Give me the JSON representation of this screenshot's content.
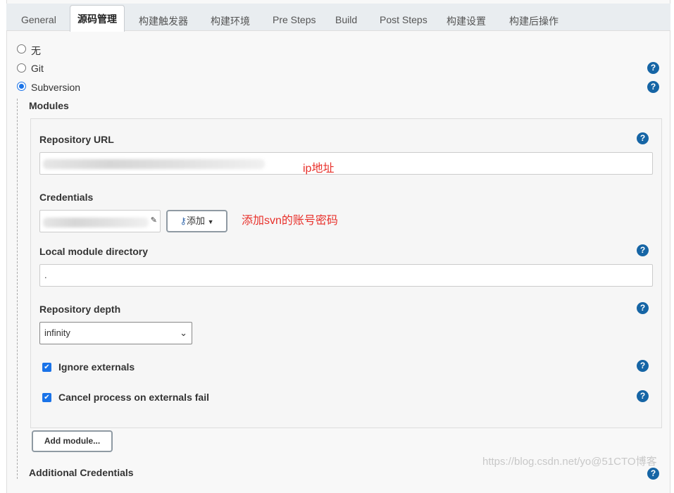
{
  "tabs": [
    {
      "label": "General"
    },
    {
      "label": "源码管理",
      "active": true
    },
    {
      "label": "构建触发器"
    },
    {
      "label": "构建环境"
    },
    {
      "label": "Pre Steps"
    },
    {
      "label": "Build"
    },
    {
      "label": "Post Steps"
    },
    {
      "label": "构建设置"
    },
    {
      "label": "构建后操作"
    }
  ],
  "scm": {
    "options": [
      {
        "label": "无",
        "selected": false
      },
      {
        "label": "Git",
        "selected": false
      },
      {
        "label": "Subversion",
        "selected": true
      }
    ]
  },
  "modules": {
    "title": "Modules",
    "repo_url_label": "Repository URL",
    "repo_url_note": "ip地址",
    "credentials_label": "Credentials",
    "add_button": "添加",
    "credentials_note": "添加svn的账号密码",
    "local_dir_label": "Local module directory",
    "local_dir_value": ".",
    "depth_label": "Repository depth",
    "depth_value": "infinity",
    "ignore_externals": {
      "label": "Ignore externals",
      "checked": true
    },
    "cancel_externals": {
      "label": "Cancel process on externals fail",
      "checked": true
    },
    "add_module_button": "Add module..."
  },
  "next_section": "Additional Credentials",
  "help_glyph": "?",
  "watermark": "https://blog.csdn.net/yo@51CTO博客",
  "colors": {
    "accent": "#1a73e8",
    "help": "#1665a5",
    "note": "#e8302a"
  }
}
